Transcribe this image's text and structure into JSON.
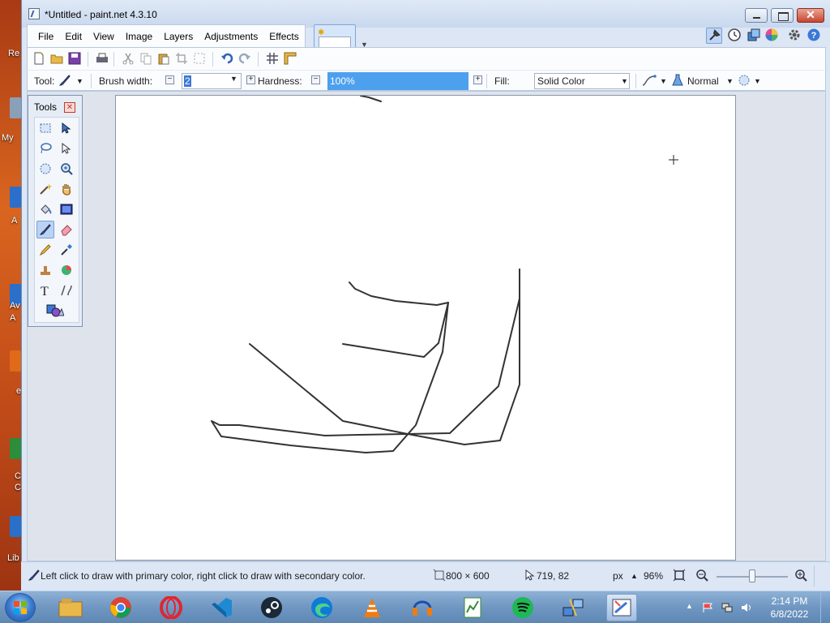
{
  "desktop": {
    "icons": [
      {
        "label": "Re"
      },
      {
        "label": "My"
      },
      {
        "label": "A"
      },
      {
        "label": "Av A"
      },
      {
        "label": "e"
      },
      {
        "label": "C C"
      },
      {
        "label": "Lib"
      }
    ]
  },
  "window": {
    "title": "*Untitled - paint.net 4.3.10",
    "buttons": {
      "close": "✕"
    }
  },
  "menu": {
    "items": [
      "File",
      "Edit",
      "View",
      "Image",
      "Layers",
      "Adjustments",
      "Effects"
    ]
  },
  "toolbar": {
    "tool_label": "Tool:",
    "brush_width_label": "Brush width:",
    "brush_width_value": "2",
    "hardness_label": "Hardness:",
    "hardness_value": "100%",
    "fill_label": "Fill:",
    "fill_value": "Solid Color",
    "blend_mode": "Normal"
  },
  "tools_panel": {
    "title": "Tools",
    "close": "✕",
    "active_tool": "paintbrush"
  },
  "status": {
    "hint": "Left click to draw with primary color, right click to draw with secondary color.",
    "image_size": "800 × 600",
    "cursor_pos": "719, 82",
    "units": "px",
    "zoom": "96%"
  },
  "taskbar": {
    "time": "2:14 PM",
    "date": "6/8/2022",
    "apps": [
      "file-explorer",
      "chrome",
      "opera",
      "vscode",
      "steam",
      "edge",
      "vlc",
      "audacity",
      "notepad-chart",
      "spotify",
      "network-tool",
      "paintnet"
    ]
  },
  "colors": {
    "accent": "#4da0ee",
    "window_bg": "#dce6f4",
    "stroke": "#333333"
  }
}
